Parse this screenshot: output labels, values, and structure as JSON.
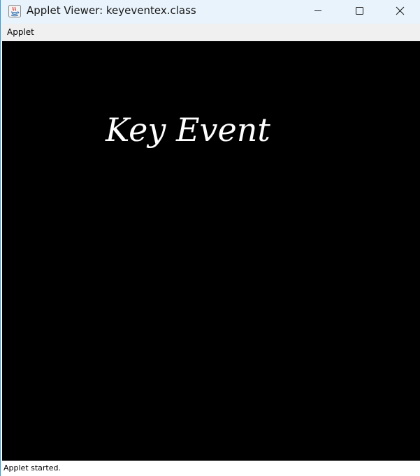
{
  "window": {
    "title": "Applet Viewer: keyeventex.class",
    "icon": "java-icon"
  },
  "menubar": {
    "items": [
      {
        "label": "Applet"
      }
    ]
  },
  "applet": {
    "text": "Key Event",
    "background_color": "#000000",
    "text_color": "#ffffff"
  },
  "statusbar": {
    "text": "Applet started."
  },
  "controls": {
    "minimize_icon": "minimize-icon",
    "maximize_icon": "maximize-icon",
    "close_icon": "close-icon"
  }
}
